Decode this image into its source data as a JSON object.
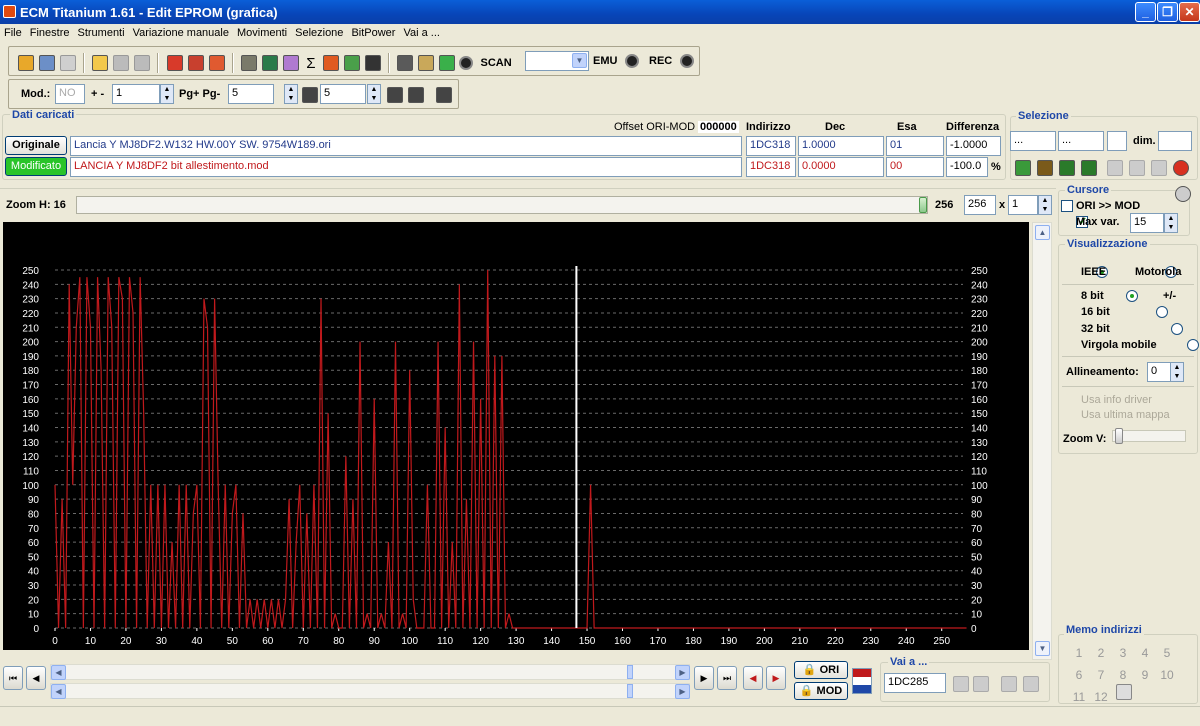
{
  "window": {
    "title": "ECM Titanium 1.61 - Edit EPROM (grafica)"
  },
  "menu": [
    "File",
    "Finestre",
    "Strumenti",
    "Variazione manuale",
    "Movimenti",
    "Selezione",
    "BitPower",
    "Vai a ..."
  ],
  "toolbar1": {
    "scan_label": "SCAN",
    "scan_value": "",
    "emu_label": "EMU",
    "rec_label": "REC"
  },
  "toolbar2": {
    "mod_label": "Mod.:",
    "mod_value": "NO",
    "plusminus_label": "+ -",
    "plusminus_value": "1",
    "pg_label": "Pg+ Pg-",
    "pg_value": "5",
    "p_value": "5"
  },
  "dati": {
    "title": "Dati caricati",
    "offset_label": "Offset ORI-MOD",
    "offset_value": "000000",
    "col_indirizzo": "Indirizzo",
    "col_dec": "Dec",
    "col_esa": "Esa",
    "col_diff": "Differenza",
    "originale": {
      "label": "Originale",
      "file": "Lancia Y MJ8DF2.W132 HW.00Y SW. 9754W189.ori",
      "indirizzo": "1DC318",
      "dec": "1.0000",
      "esa": "01",
      "diff": "-1.0000"
    },
    "modificato": {
      "label": "Modificato",
      "file": "LANCIA Y MJ8DF2 bit allestimento.mod",
      "indirizzo": "1DC318",
      "dec": "0.0000",
      "esa": "00",
      "diff": "-100.0",
      "percent": "%"
    }
  },
  "selezione": {
    "title": "Selezione",
    "from": "...",
    "to": "...",
    "dim_label": "dim.",
    "dim_value": ""
  },
  "zoom": {
    "label": "Zoom H: 16",
    "value": "256",
    "input": "256",
    "times": "x",
    "mult": "1"
  },
  "cursore": {
    "title": "Cursore",
    "ori_mod": "ORI >> MOD",
    "max_var": "Max var.",
    "max_var_value": "15"
  },
  "visualizzazione": {
    "title": "Visualizzazione",
    "ieee": "IEEE",
    "motorola": "Motorola",
    "bit8": "8 bit",
    "plusminus": "+/-",
    "bit16": "16 bit",
    "bit32": "32 bit",
    "virgola": "Virgola mobile",
    "allineamento": "Allineamento:",
    "allineamento_value": "0",
    "usa_info": "Usa info driver",
    "usa_ultima": "Usa ultima mappa",
    "zoom_v": "Zoom V:"
  },
  "memo": {
    "title": "Memo indirizzi",
    "numbers": [
      "1",
      "2",
      "3",
      "4",
      "5",
      "6",
      "7",
      "8",
      "9",
      "10",
      "11",
      "12"
    ]
  },
  "bottom": {
    "ori_label": "ORI",
    "mod_label": "MOD",
    "vai_title": "Vai a ...",
    "vai_value": "1DC285"
  },
  "chart_data": {
    "type": "line",
    "ylim": [
      0,
      250
    ],
    "xlim": [
      0,
      256
    ],
    "yticks": [
      0,
      10,
      20,
      30,
      40,
      50,
      60,
      70,
      80,
      90,
      100,
      110,
      120,
      130,
      140,
      150,
      160,
      170,
      180,
      190,
      200,
      210,
      220,
      230,
      240,
      250
    ],
    "xticks": [
      0,
      10,
      20,
      30,
      40,
      50,
      60,
      70,
      80,
      90,
      100,
      110,
      120,
      130,
      140,
      150,
      160,
      170,
      180,
      190,
      200,
      210,
      220,
      230,
      240,
      250
    ],
    "cursor_x": 147,
    "colors": {
      "series": "#c0191c",
      "background": "#000000",
      "grid": "#6a6a6a",
      "axis_text": "#ffffff",
      "cursor": "#ffffff"
    },
    "series": [
      {
        "values": [
          100,
          0,
          90,
          0,
          240,
          100,
          210,
          245,
          0,
          245,
          210,
          0,
          245,
          180,
          0,
          245,
          210,
          0,
          245,
          230,
          0,
          245,
          220,
          0,
          245,
          150,
          0,
          100,
          0,
          100,
          0,
          100,
          0,
          60,
          0,
          100,
          0,
          100,
          0,
          80,
          100,
          0,
          230,
          210,
          0,
          230,
          100,
          0,
          100,
          0,
          80,
          100,
          0,
          80,
          0,
          20,
          0,
          20,
          0,
          20,
          0,
          20,
          0,
          20,
          0,
          20,
          90,
          0,
          60,
          100,
          0,
          80,
          0,
          100,
          0,
          230,
          0,
          150,
          0,
          10,
          0,
          0,
          120,
          0,
          90,
          0,
          200,
          0,
          10,
          0,
          160,
          0,
          10,
          0,
          60,
          0,
          200,
          0,
          10,
          0,
          180,
          20,
          0,
          0,
          0,
          100,
          0,
          0,
          200,
          0,
          140,
          0,
          60,
          0,
          240,
          0,
          90,
          0,
          200,
          0,
          160,
          0,
          250,
          0,
          190,
          0,
          190,
          0,
          10,
          0,
          0,
          0,
          0,
          0,
          0,
          0,
          0,
          0,
          0,
          0,
          0,
          0,
          0,
          0,
          0,
          0,
          0,
          0,
          0,
          0,
          0,
          100,
          0,
          0,
          0,
          0,
          0,
          0,
          0,
          0,
          0,
          0,
          0,
          0,
          0,
          0,
          0,
          0,
          0,
          0,
          0,
          0,
          0,
          0,
          0,
          0,
          0,
          0,
          0,
          0,
          0,
          0,
          0,
          0,
          0,
          0,
          0,
          0,
          0,
          0,
          0,
          0,
          0,
          0,
          0,
          0,
          0,
          0,
          0,
          0,
          0,
          0,
          0,
          0,
          0,
          0,
          0,
          0,
          0,
          0,
          0,
          0,
          0,
          0,
          0,
          0,
          0,
          0,
          0,
          0,
          0,
          0,
          0,
          0,
          0,
          0,
          0,
          0,
          0,
          0,
          0,
          0,
          0,
          0,
          0,
          0,
          0,
          0,
          0,
          0,
          0,
          0,
          0,
          0,
          0,
          0,
          0,
          0,
          0,
          0,
          0,
          0,
          0,
          0,
          0,
          0,
          0,
          0
        ]
      }
    ]
  }
}
